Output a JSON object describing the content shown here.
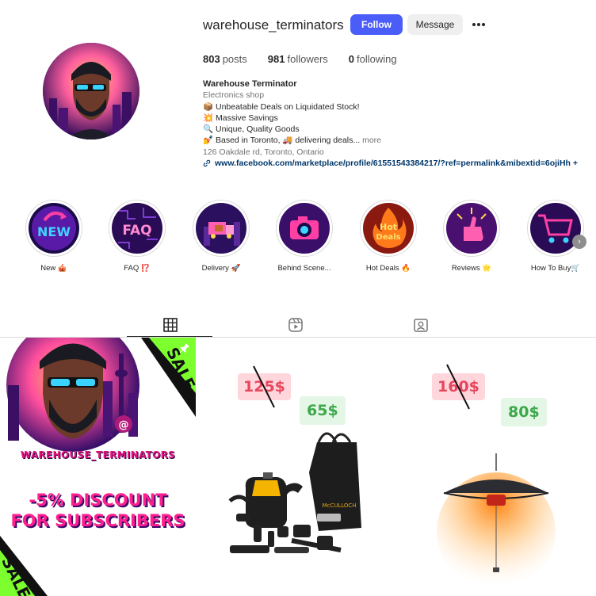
{
  "profile": {
    "username": "warehouse_terminators",
    "follow_label": "Follow",
    "message_label": "Message",
    "more_icon": "more-options-icon"
  },
  "stats": {
    "posts_count": "803",
    "posts_label": "posts",
    "followers_count": "981",
    "followers_label": "followers",
    "following_count": "0",
    "following_label": "following"
  },
  "bio": {
    "name": "Warehouse Terminator",
    "category": "Electronics shop",
    "line1": "📦 Unbeatable Deals on Liquidated Stock!",
    "line2": "💥 Massive Savings",
    "line3": "🔍 Unique, Quality Goods",
    "line4": "💅 Based in Toronto, 🚚 delivering deals...",
    "more_label": "more",
    "address": "126 Oakdale rd, Toronto, Ontario",
    "link": "www.facebook.com/marketplace/profile/61551543384217/?ref=permalink&mibextid=6ojiHh +"
  },
  "highlights": [
    {
      "label": "New 🎪",
      "icon": "new-highlight"
    },
    {
      "label": "FAQ ⁉️",
      "icon": "faq-highlight"
    },
    {
      "label": "Delivery 🚀",
      "icon": "delivery-highlight"
    },
    {
      "label": "Behind Scene...",
      "icon": "camera-highlight"
    },
    {
      "label": "Hot Deals 🔥",
      "icon": "hot-deals-highlight"
    },
    {
      "label": "Reviews 🌟",
      "icon": "reviews-highlight"
    },
    {
      "label": "How To Buy🛒",
      "icon": "cart-highlight"
    }
  ],
  "tabs": [
    {
      "name": "posts",
      "icon": "grid-icon",
      "active": true
    },
    {
      "name": "reels",
      "icon": "reels-icon",
      "active": false
    },
    {
      "name": "tagged",
      "icon": "tagged-icon",
      "active": false
    }
  ],
  "posts": {
    "p1": {
      "sale_text": "SALE",
      "at_symbol": "@",
      "handle": "WAREHOUSE_TERMINATORS",
      "discount_line1": "-5% DISCOUNT",
      "discount_line2": "FOR SUBSCRIBERS"
    },
    "p2": {
      "old_price": "125$",
      "new_price": "65$",
      "product": "steam cleaner with bag and accessories"
    },
    "p3": {
      "old_price": "160$",
      "new_price": "80$",
      "product": "hanging patio heater"
    }
  },
  "colors": {
    "follow_button": "#4a5df9",
    "link": "#00376b",
    "old_price": "#e8465d",
    "new_price": "#3ca84a",
    "accent_pink": "#ff1f8e"
  }
}
